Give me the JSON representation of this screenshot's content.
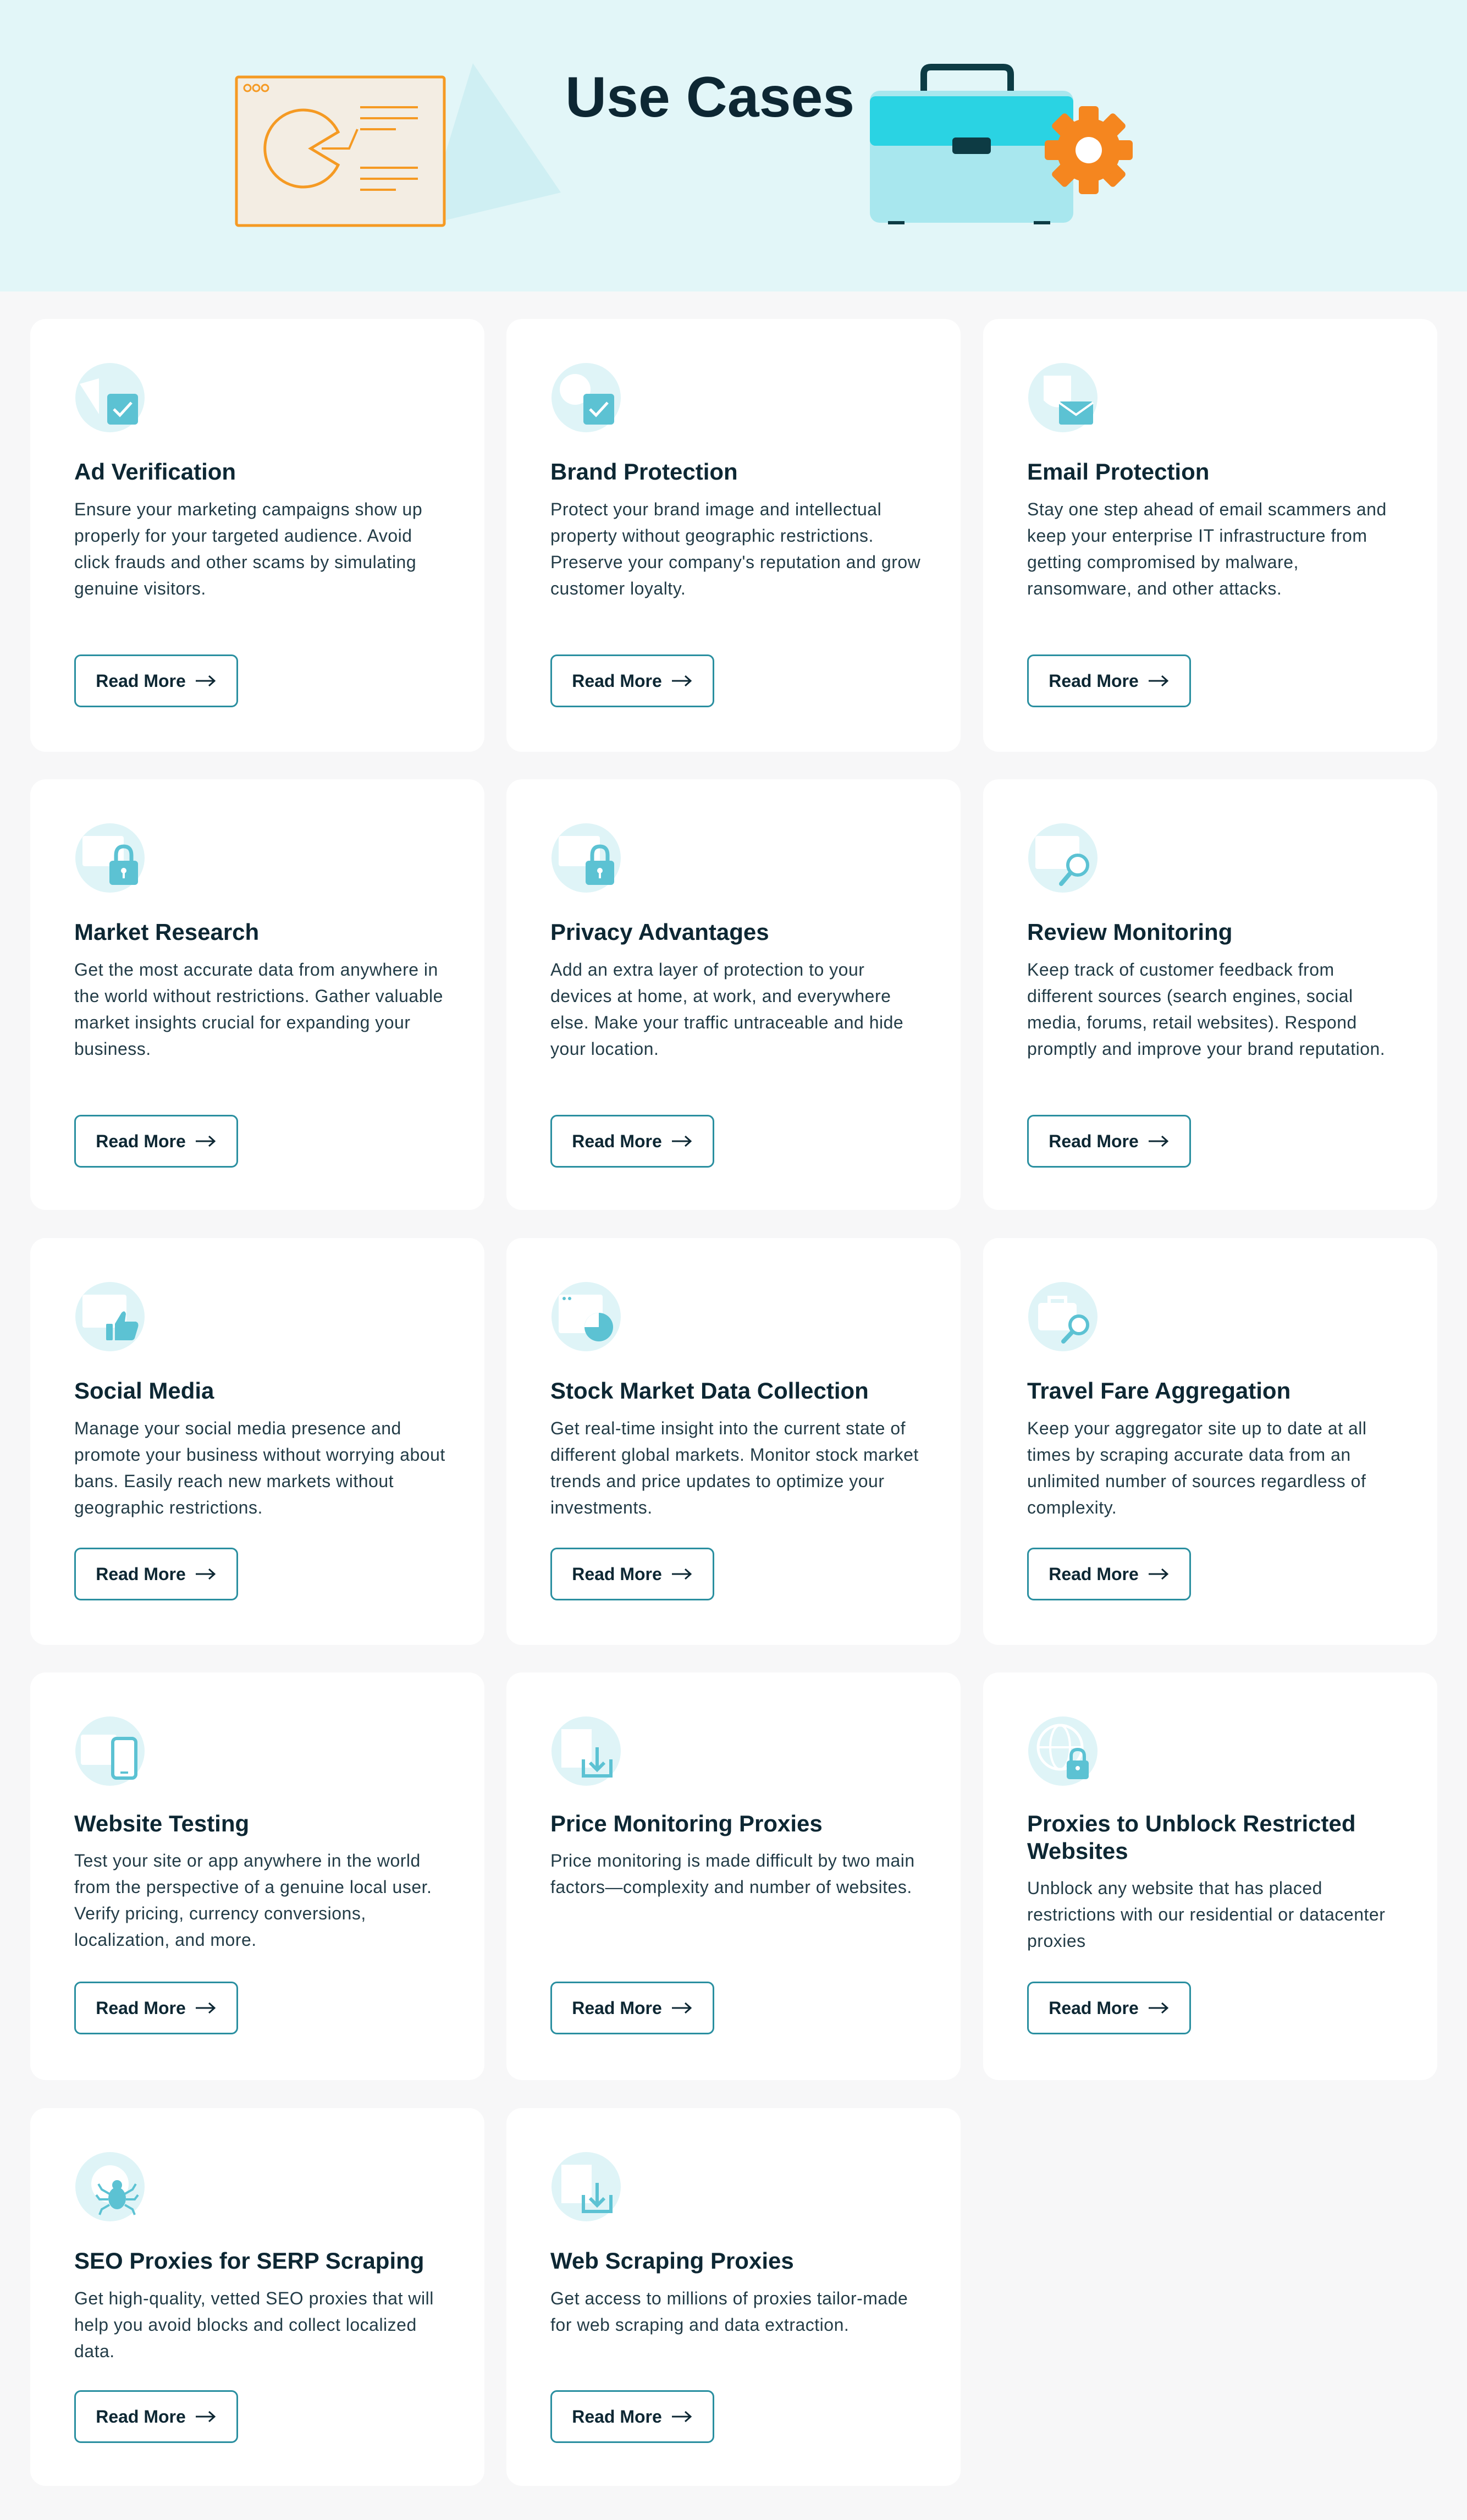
{
  "header": {
    "title": "Use Cases"
  },
  "cards": [
    {
      "title": "Ad Verification",
      "desc": "Ensure your marketing campaigns show up properly for your targeted audience. Avoid click frauds and other scams by simulating genuine visitors.",
      "button": "Read More",
      "icon": "ad-check-icon"
    },
    {
      "title": "Brand Protection",
      "desc": "Protect your brand image and intellectual property without geographic restrictions. Preserve your company's reputation and grow customer loyalty.",
      "button": "Read More",
      "icon": "brand-check-icon"
    },
    {
      "title": "Email Protection",
      "desc": "Stay one step ahead of email scammers and keep your enterprise IT infrastructure from getting compromised by malware, ransomware, and other attacks.",
      "button": "Read More",
      "icon": "envelope-shield-icon"
    },
    {
      "title": "Market Research",
      "desc": "Get the most accurate data from anywhere in the world without restrictions. Gather valuable market insights crucial for expanding your business.",
      "button": "Read More",
      "icon": "lock-browser-icon"
    },
    {
      "title": "Privacy Advantages",
      "desc": "Add an extra layer of protection to your devices at home, at work, and everywhere else. Make your traffic untraceable and hide your location.",
      "button": "Read More",
      "icon": "lock-browser-icon"
    },
    {
      "title": "Review Monitoring",
      "desc": "Keep track of customer feedback from different sources (search engines, social media, forums, retail websites). Respond promptly and improve your brand reputation.",
      "button": "Read More",
      "icon": "magnifier-icon"
    },
    {
      "title": "Social Media",
      "desc": "Manage your social media presence and promote your business without worrying about bans. Easily reach new markets without geographic restrictions.",
      "button": "Read More",
      "icon": "thumbs-up-icon"
    },
    {
      "title": "Stock Market Data Collection",
      "desc": "Get real-time insight into the current state of different global markets. Monitor stock market trends and price updates to optimize your investments.",
      "button": "Read More",
      "icon": "pie-chart-icon"
    },
    {
      "title": "Travel Fare Aggregation",
      "desc": "Keep your aggregator site up to date at all times by scraping accurate data from an unlimited number of sources regardless of complexity.",
      "button": "Read More",
      "icon": "suitcase-search-icon"
    },
    {
      "title": "Website Testing",
      "desc": "Test your site or app anywhere in the world from the perspective of a genuine local user. Verify pricing, currency conversions, localization, and more.",
      "button": "Read More",
      "icon": "phone-icon"
    },
    {
      "title": "Price Monitoring Proxies",
      "desc": "Price monitoring is made difficult by two main factors—complexity and number of websites.",
      "button": "Read More",
      "icon": "download-tray-icon"
    },
    {
      "title": "Proxies to Unblock Restricted Websites",
      "desc": "Unblock any website that has placed restrictions with our residential or datacenter proxies",
      "button": "Read More",
      "icon": "globe-lock-icon"
    },
    {
      "title": "SEO Proxies for SERP Scraping",
      "desc": "Get high-quality, vetted SEO proxies that will help you avoid blocks and collect localized data.",
      "button": "Read More",
      "icon": "spider-icon"
    },
    {
      "title": "Web Scraping Proxies",
      "desc": "Get access to millions of proxies tailor-made for web scraping and data extraction.",
      "button": "Read More",
      "icon": "download-tray-icon"
    }
  ],
  "colors": {
    "hero_bg": "#e2f6f8",
    "accent": "#2a8fa0",
    "icon_bg": "#dff4f7",
    "icon_fg": "#5cc2d3",
    "orange": "#f59a23"
  }
}
